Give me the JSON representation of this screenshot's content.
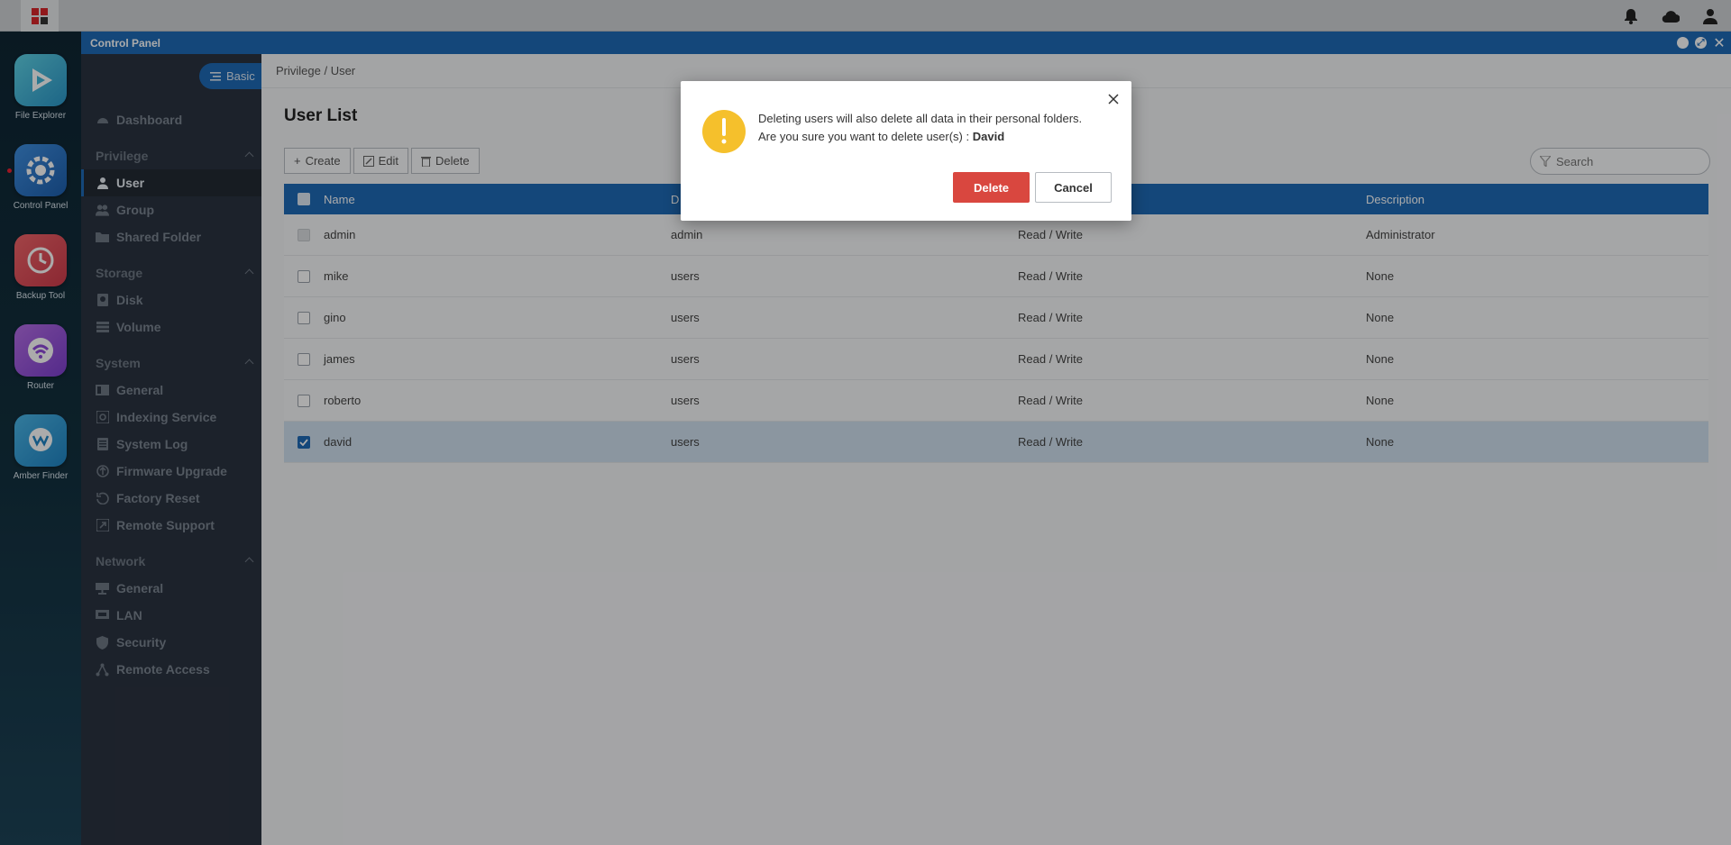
{
  "window": {
    "title": "Control Panel"
  },
  "dock": [
    {
      "label": "File Explorer",
      "icon": "file-explorer-icon"
    },
    {
      "label": "Control Panel",
      "icon": "control-panel-icon"
    },
    {
      "label": "Backup Tool",
      "icon": "backup-tool-icon"
    },
    {
      "label": "Router",
      "icon": "router-icon"
    },
    {
      "label": "Amber Finder",
      "icon": "amber-finder-icon"
    }
  ],
  "sidebar": {
    "mode_button": "Basic",
    "dashboard": "Dashboard",
    "groups": [
      {
        "label": "Privilege",
        "items": [
          "User",
          "Group",
          "Shared Folder"
        ]
      },
      {
        "label": "Storage",
        "items": [
          "Disk",
          "Volume"
        ]
      },
      {
        "label": "System",
        "items": [
          "General",
          "Indexing Service",
          "System Log",
          "Firmware Upgrade",
          "Factory Reset",
          "Remote Support"
        ]
      },
      {
        "label": "Network",
        "items": [
          "General",
          "LAN",
          "Security",
          "Remote Access"
        ]
      }
    ],
    "active_item": "User"
  },
  "main": {
    "breadcrumb": "Privilege / User",
    "title": "User List",
    "toolbar": {
      "create": "Create",
      "edit": "Edit",
      "delete": "Delete"
    },
    "search_placeholder": "Search",
    "table": {
      "headers": [
        "Name",
        "D",
        "",
        "Description"
      ],
      "rows": [
        {
          "name": "admin",
          "group": "admin",
          "permission": "Read / Write",
          "description": "Administrator",
          "checked": false,
          "disabled": true
        },
        {
          "name": "mike",
          "group": "users",
          "permission": "Read / Write",
          "description": "None",
          "checked": false,
          "disabled": false
        },
        {
          "name": "gino",
          "group": "users",
          "permission": "Read / Write",
          "description": "None",
          "checked": false,
          "disabled": false
        },
        {
          "name": "james",
          "group": "users",
          "permission": "Read / Write",
          "description": "None",
          "checked": false,
          "disabled": false
        },
        {
          "name": "roberto",
          "group": "users",
          "permission": "Read / Write",
          "description": "None",
          "checked": false,
          "disabled": false
        },
        {
          "name": "david",
          "group": "users",
          "permission": "Read / Write",
          "description": "None",
          "checked": true,
          "disabled": false
        }
      ]
    }
  },
  "dialog": {
    "message": "Deleting users will also delete all data in their personal folders. Are you sure you want to delete user(s) : ",
    "target_user": "David",
    "confirm_label": "Delete",
    "cancel_label": "Cancel"
  },
  "colors": {
    "accent": "#1f6ab6",
    "danger": "#d9473f",
    "warning": "#f5c02c"
  }
}
